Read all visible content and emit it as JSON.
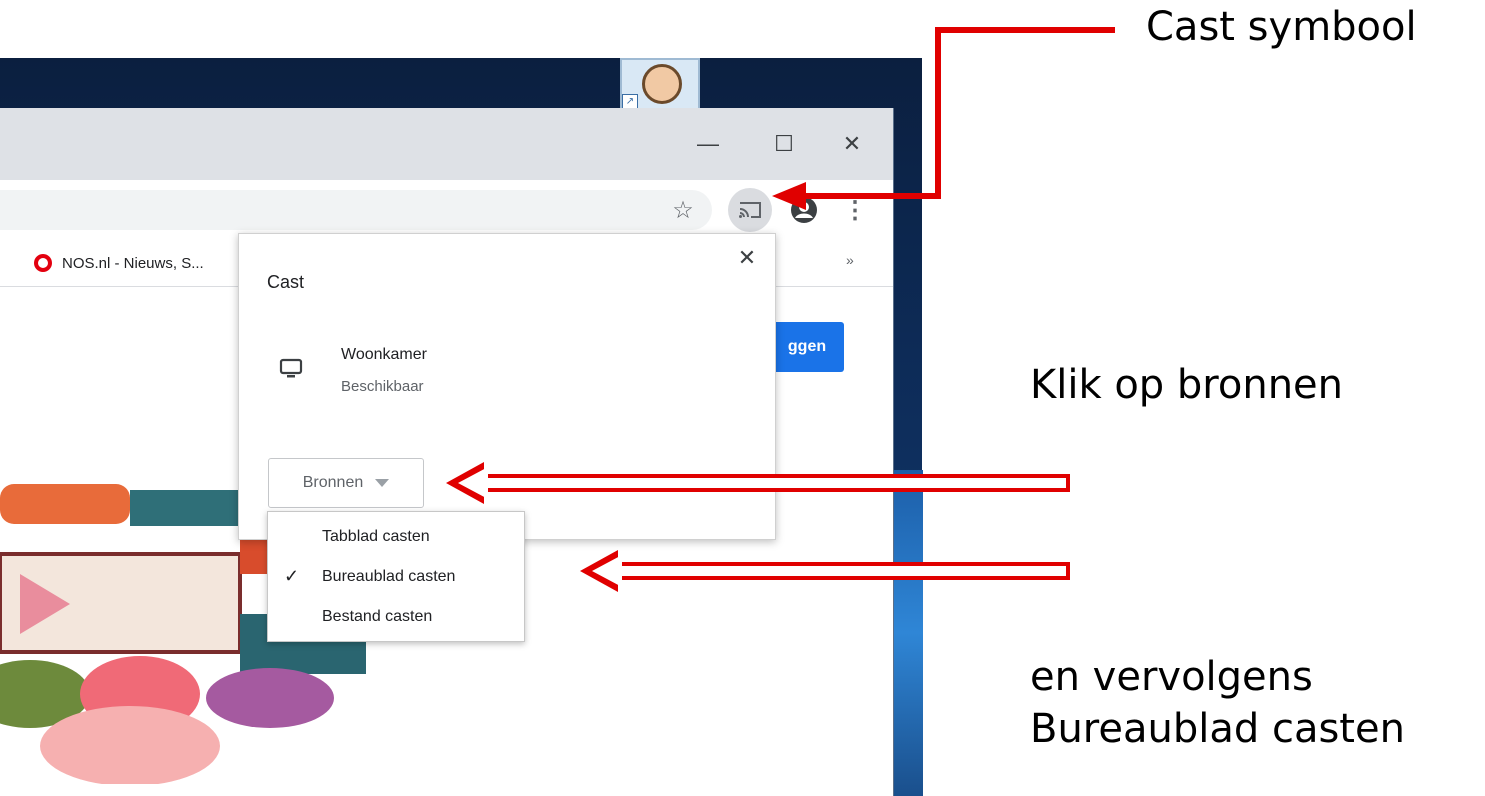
{
  "browser": {
    "window_controls": {
      "minimize": "—",
      "maximize": "☐",
      "close": "✕"
    },
    "toolbar": {
      "bookmark_icon": "star-icon",
      "cast_icon": "cast-icon",
      "profile_icon": "account-icon",
      "menu_icon": "⋮"
    },
    "bookmarks_bar": {
      "items": [
        {
          "label": "NOS.nl - Nieuws, S...",
          "icon": "nos-logo-icon"
        }
      ],
      "more": "»"
    },
    "page": {
      "signin_button": "ggen"
    }
  },
  "cast_dialog": {
    "title": "Cast",
    "close": "✕",
    "sink": {
      "name": "Woonkamer",
      "status": "Beschikbaar",
      "icon": "monitor-icon"
    },
    "sources_button": "Bronnen",
    "sources_menu": {
      "items": [
        {
          "label": "Tabblad casten",
          "checked": false
        },
        {
          "label": "Bureaublad casten",
          "checked": true
        },
        {
          "label": "Bestand casten",
          "checked": false
        }
      ],
      "check_glyph": "✓"
    }
  },
  "annotations": {
    "cast_symbol": "Cast symbool",
    "click_sources": "Klik op bronnen",
    "then_line1": "en vervolgens",
    "then_line2": "Bureaublad casten",
    "arrow_color": "#e00000"
  },
  "colors": {
    "accent_blue": "#1a73e8",
    "titlebar": "#dee1e6",
    "nos_red": "#e3000f"
  }
}
